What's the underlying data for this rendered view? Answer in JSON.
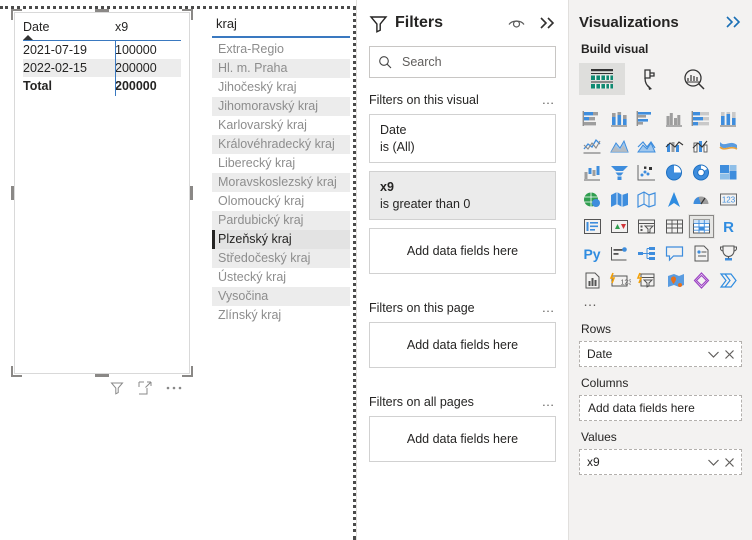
{
  "canvas": {
    "matrix_visual": {
      "columns": [
        "Date",
        "x9"
      ],
      "sort_indicator": "sort-ascending",
      "rows": [
        {
          "date": "2021-07-19",
          "x9": "100000"
        },
        {
          "date": "2022-02-15",
          "x9": "200000"
        }
      ],
      "total_row": {
        "label": "Total",
        "x9": "200000"
      },
      "toolbar": {
        "filter_icon": "filter-icon",
        "focus_icon": "focus-mode-icon",
        "more_icon": "more-options-icon"
      }
    },
    "slicer": {
      "title": "kraj",
      "items": [
        {
          "label": "Extra-Regio",
          "selected": false
        },
        {
          "label": "Hl. m. Praha",
          "selected": false
        },
        {
          "label": "Jihočeský kraj",
          "selected": false
        },
        {
          "label": "Jihomoravský kraj",
          "selected": false
        },
        {
          "label": "Karlovarský kraj",
          "selected": false
        },
        {
          "label": "Královéhradecký kraj",
          "selected": false
        },
        {
          "label": "Liberecký kraj",
          "selected": false
        },
        {
          "label": "Moravskoslezský kraj",
          "selected": false
        },
        {
          "label": "Olomoucký kraj",
          "selected": false
        },
        {
          "label": "Pardubický kraj",
          "selected": false
        },
        {
          "label": "Plzeňský kraj",
          "selected": true
        },
        {
          "label": "Středočeský kraj",
          "selected": false
        },
        {
          "label": "Ústecký kraj",
          "selected": false
        },
        {
          "label": "Vysočina",
          "selected": false
        },
        {
          "label": "Zlínský kraj",
          "selected": false
        }
      ]
    }
  },
  "filters_pane": {
    "title": "Filters",
    "eye_icon": "eye-icon",
    "expand_icon": "double-chevron-right-icon",
    "search": {
      "placeholder": "Search",
      "value": "",
      "icon": "search-icon"
    },
    "sections": [
      {
        "heading": "Filters on this visual",
        "menu": "…",
        "cards": [
          {
            "name": "Date",
            "condition": "is (All)",
            "active": false
          },
          {
            "name": "x9",
            "condition": "is greater than 0",
            "active": true
          }
        ],
        "dropzone": "Add data fields here"
      },
      {
        "heading": "Filters on this page",
        "menu": "…",
        "cards": [],
        "dropzone": "Add data fields here"
      },
      {
        "heading": "Filters on all pages",
        "menu": "…",
        "cards": [],
        "dropzone": "Add data fields here"
      }
    ]
  },
  "visualizations_pane": {
    "title": "Visualizations",
    "expand_icon": "double-chevron-right-icon",
    "build_label": "Build visual",
    "tabs": [
      {
        "name": "build-visual-tab",
        "icon": "fields-build-icon",
        "selected": true
      },
      {
        "name": "format-visual-tab",
        "icon": "paint-roller-icon",
        "selected": false
      },
      {
        "name": "analytics-tab",
        "icon": "magnifier-chart-icon",
        "selected": false
      }
    ],
    "chart_types": [
      {
        "icon": "stacked-bar-chart-icon",
        "selected": false
      },
      {
        "icon": "stacked-column-chart-icon",
        "selected": false
      },
      {
        "icon": "clustered-bar-chart-icon",
        "selected": false
      },
      {
        "icon": "clustered-column-chart-icon",
        "selected": false
      },
      {
        "icon": "100-stacked-bar-chart-icon",
        "selected": false
      },
      {
        "icon": "100-stacked-column-chart-icon",
        "selected": false
      },
      {
        "icon": "line-chart-icon",
        "selected": false
      },
      {
        "icon": "area-chart-icon",
        "selected": false
      },
      {
        "icon": "stacked-area-chart-icon",
        "selected": false
      },
      {
        "icon": "line-stacked-column-chart-icon",
        "selected": false
      },
      {
        "icon": "line-clustered-column-chart-icon",
        "selected": false
      },
      {
        "icon": "ribbon-chart-icon",
        "selected": false
      },
      {
        "icon": "waterfall-chart-icon",
        "selected": false
      },
      {
        "icon": "funnel-chart-icon",
        "selected": false
      },
      {
        "icon": "scatter-chart-icon",
        "selected": false
      },
      {
        "icon": "pie-chart-icon",
        "selected": false
      },
      {
        "icon": "donut-chart-icon",
        "selected": false
      },
      {
        "icon": "treemap-icon",
        "selected": false
      },
      {
        "icon": "map-icon",
        "selected": false
      },
      {
        "icon": "filled-map-icon",
        "selected": false
      },
      {
        "icon": "shape-map-icon",
        "selected": false
      },
      {
        "icon": "azure-map-icon",
        "selected": false
      },
      {
        "icon": "gauge-icon",
        "selected": false
      },
      {
        "icon": "card-number-icon",
        "selected": false
      },
      {
        "icon": "multi-row-card-icon",
        "selected": false
      },
      {
        "icon": "kpi-icon",
        "selected": false
      },
      {
        "icon": "slicer-icon",
        "selected": false
      },
      {
        "icon": "table-icon",
        "selected": false
      },
      {
        "icon": "matrix-icon",
        "selected": true
      },
      {
        "icon": "r-script-visual-icon",
        "selected": false
      },
      {
        "icon": "python-visual-icon",
        "selected": false
      },
      {
        "icon": "key-influencers-icon",
        "selected": false
      },
      {
        "icon": "decomposition-tree-icon",
        "selected": false
      },
      {
        "icon": "qa-visual-icon",
        "selected": false
      },
      {
        "icon": "smart-narrative-icon",
        "selected": false
      },
      {
        "icon": "metrics-icon",
        "selected": false
      },
      {
        "icon": "paginated-report-icon",
        "selected": false
      },
      {
        "icon": "power-apps-icon",
        "selected": false
      },
      {
        "icon": "power-automate-icon",
        "selected": false
      },
      {
        "icon": "arcgis-map-icon",
        "selected": false
      },
      {
        "icon": "visio-icon",
        "selected": false
      },
      {
        "icon": "zebra-bi-icon",
        "selected": false
      }
    ],
    "more_visuals": "…",
    "wells": [
      {
        "label": "Rows",
        "value": "Date",
        "empty": false
      },
      {
        "label": "Columns",
        "value": "Add data fields here",
        "empty": true
      },
      {
        "label": "Values",
        "value": "x9",
        "empty": false
      }
    ]
  }
}
